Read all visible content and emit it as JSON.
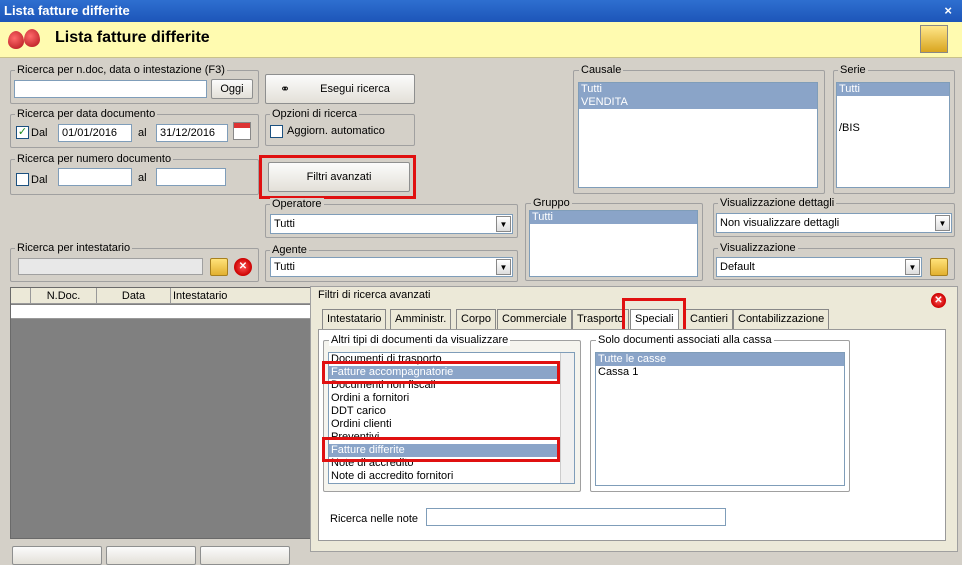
{
  "window": {
    "title": "Lista fatture differite",
    "close": "×"
  },
  "header": {
    "title": "Lista fatture differite"
  },
  "search": {
    "ndoc_label": "Ricerca per n.doc, data o intestazione (F3)",
    "ndoc_value": "",
    "oggi": "Oggi",
    "date_label": "Ricerca per data documento",
    "dal": "Dal",
    "al": "al",
    "date_from": "01/01/2016",
    "date_to": "31/12/2016",
    "num_label": "Ricerca per numero documento",
    "num_from": "",
    "num_to": "",
    "intest_label": "Ricerca per intestatario"
  },
  "actions": {
    "esegui": "Esegui ricerca",
    "opzioni_label": "Opzioni di ricerca",
    "aggiorn": "Aggiorn. automatico",
    "filtri": "Filtri avanzati"
  },
  "causale": {
    "label": "Causale",
    "items": [
      "Tutti",
      "VENDITA"
    ]
  },
  "serie": {
    "label": "Serie",
    "items": [
      "Tutti",
      "",
      "",
      "/BIS"
    ]
  },
  "operatore": {
    "label": "Operatore",
    "value": "Tutti"
  },
  "agente": {
    "label": "Agente",
    "value": "Tutti"
  },
  "gruppo": {
    "label": "Gruppo",
    "items": [
      "Tutti"
    ]
  },
  "vis_dettagli": {
    "label": "Visualizzazione dettagli",
    "value": "Non visualizzare dettagli"
  },
  "visualizzazione": {
    "label": "Visualizzazione",
    "value": "Default"
  },
  "grid": {
    "columns": [
      "N.Doc.",
      "Data",
      "Intestatario"
    ]
  },
  "advanced": {
    "title": "Filtri di ricerca avanzati",
    "tabs": [
      "Intestatario",
      "Amministr.",
      "Corpo",
      "Commerciale",
      "Trasporto",
      "Speciali",
      "Cantieri",
      "Contabilizzazione"
    ],
    "altri_label": "Altri tipi di documenti da visualizzare",
    "altri_items": [
      "Documenti di trasporto",
      "Fatture accompagnatorie",
      "Documenti non fiscali",
      "Ordini a fornitori",
      "DDT carico",
      "Ordini clienti",
      "Preventivi",
      "Fatture differite",
      "Note di accredito",
      "Note di accredito fornitori"
    ],
    "cassa_label": "Solo documenti associati alla cassa",
    "cassa_items": [
      "Tutte le casse",
      "Cassa 1"
    ],
    "note_label": "Ricerca nelle note",
    "note_value": ""
  }
}
